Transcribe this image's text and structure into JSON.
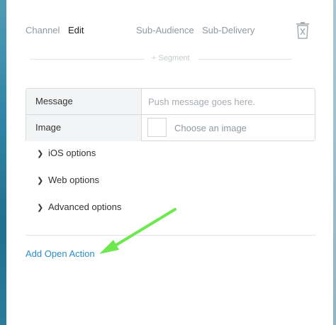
{
  "tabs": {
    "channel": "Channel",
    "edit": "Edit",
    "sub_audience": "Sub-Audience",
    "sub_delivery": "Sub-Delivery"
  },
  "segment": {
    "label": "+ Segment"
  },
  "form": {
    "message_label": "Message",
    "message_placeholder": "Push message goes here.",
    "message_value": "",
    "image_label": "Image",
    "image_choose": "Choose an image"
  },
  "options": {
    "ios": "iOS options",
    "web": "Web options",
    "advanced": "Advanced options"
  },
  "actions": {
    "add_open_action": "Add Open Action"
  },
  "icons": {
    "delete": "trash-icon",
    "chevron": "chevron-right-icon",
    "annotation": "green-arrow-icon"
  },
  "colors": {
    "link": "#2a8ec9",
    "arrow": "#6ee84f",
    "muted_text": "#8f98a0"
  }
}
